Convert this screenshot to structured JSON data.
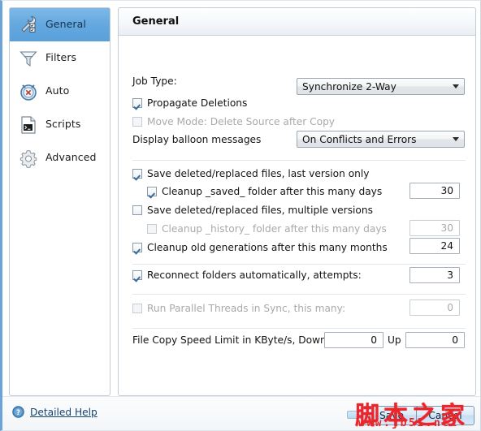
{
  "window": {
    "accent_color": "#6ba4d9",
    "panel_border": "#c3ccd5"
  },
  "sidebar": {
    "items": [
      {
        "label": "General",
        "icon": "wrench-icon",
        "active": true
      },
      {
        "label": "Filters",
        "icon": "funnel-icon",
        "active": false
      },
      {
        "label": "Auto",
        "icon": "clock-icon",
        "active": false
      },
      {
        "label": "Scripts",
        "icon": "script-icon",
        "active": false
      },
      {
        "label": "Advanced",
        "icon": "gear-icon",
        "active": false
      }
    ]
  },
  "main": {
    "title": "General",
    "job_type": {
      "label": "Job Type:",
      "value": "Synchronize 2-Way"
    },
    "propagate_deletions": {
      "label": "Propagate Deletions",
      "checked": true,
      "enabled": true
    },
    "move_mode": {
      "label": "Move Mode: Delete Source after Copy",
      "checked": false,
      "enabled": false
    },
    "balloon": {
      "label": "Display balloon messages",
      "value": "On Conflicts and Errors"
    },
    "save_last_version": {
      "label": "Save deleted/replaced files, last version only",
      "checked": true,
      "enabled": true
    },
    "cleanup_saved": {
      "label": "Cleanup _saved_ folder after this many days",
      "checked": true,
      "enabled": true,
      "value": "30"
    },
    "save_multiple_versions": {
      "label": "Save deleted/replaced files, multiple versions",
      "checked": false,
      "enabled": true
    },
    "cleanup_history": {
      "label": "Cleanup _history_ folder after this many days",
      "checked": false,
      "enabled": false,
      "value": "30"
    },
    "cleanup_generations": {
      "label": "Cleanup old generations after this many months",
      "checked": true,
      "enabled": true,
      "value": "24"
    },
    "reconnect": {
      "label": "Reconnect folders automatically, attempts:",
      "checked": true,
      "enabled": true,
      "value": "3"
    },
    "parallel_threads": {
      "label": "Run Parallel Threads in Sync, this many:",
      "checked": false,
      "enabled": false,
      "value": "0"
    },
    "speed_limit": {
      "label": "File Copy Speed Limit in KByte/s, Down",
      "down_value": "0",
      "up_label": "Up",
      "up_value": "0"
    }
  },
  "footer": {
    "help_icon": "question-mark-icon",
    "help_label": "Detailed Help",
    "save_label": "Save",
    "cancel_label": "Cancel"
  },
  "watermark": {
    "text_cn": "脚本之家",
    "text_url": "www.jb51.net",
    "color": "#e8262c"
  }
}
